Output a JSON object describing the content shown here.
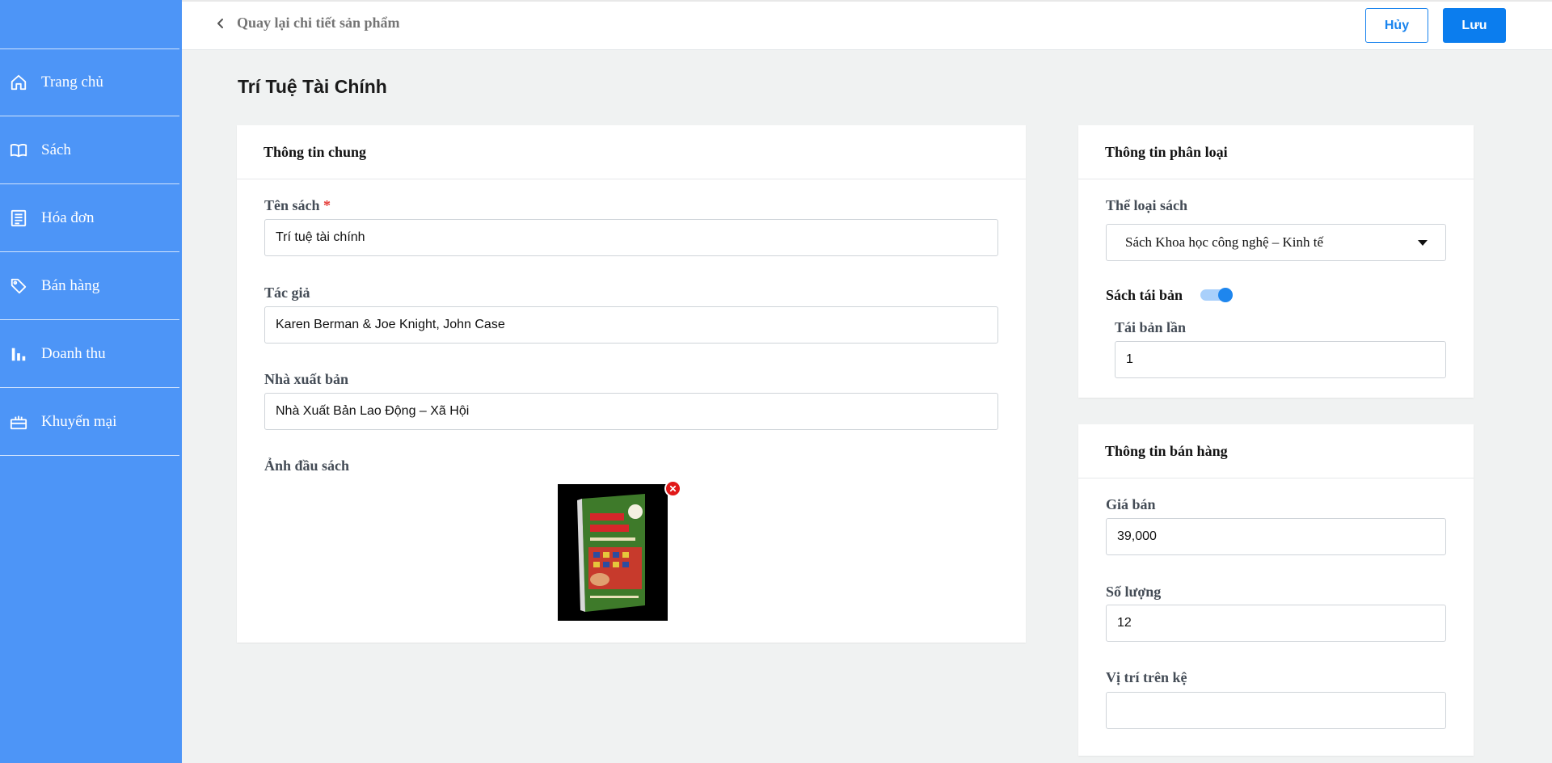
{
  "sidebar": {
    "items": [
      {
        "label": "Trang chủ",
        "icon": "home-icon"
      },
      {
        "label": "Sách",
        "icon": "book-icon"
      },
      {
        "label": "Hóa đơn",
        "icon": "receipt-icon"
      },
      {
        "label": "Bán hàng",
        "icon": "tag-icon"
      },
      {
        "label": "Doanh thu",
        "icon": "bar-chart-icon"
      },
      {
        "label": "Khuyến mại",
        "icon": "gift-icon"
      }
    ]
  },
  "header": {
    "back_label": "Quay lại chi tiết sản phẩm",
    "cancel_label": "Hủy",
    "save_label": "Lưu"
  },
  "page": {
    "title": "Trí Tuệ Tài Chính"
  },
  "general": {
    "heading": "Thông tin chung",
    "name_label": "Tên sách",
    "name_required": "*",
    "name_value": "Trí tuệ tài chính",
    "author_label": "Tác giả",
    "author_value": "Karen Berman & Joe Knight, John Case",
    "publisher_label": "Nhà xuất bản",
    "publisher_value": "Nhà Xuất Bản Lao Động – Xã Hội",
    "cover_label": "Ảnh đầu sách"
  },
  "classification": {
    "heading": "Thông tin phân loại",
    "category_label": "Thể loại sách",
    "category_value": "Sách Khoa học công nghệ – Kinh tế",
    "reprint_label": "Sách tái bản",
    "reprint_on": true,
    "reprint_count_label": "Tái bản lần",
    "reprint_count_value": "1"
  },
  "sales": {
    "heading": "Thông tin bán hàng",
    "price_label": "Giá bán",
    "price_value": "39,000",
    "quantity_label": "Số lượng",
    "quantity_value": "12",
    "shelf_label": "Vị trí trên kệ",
    "shelf_value": ""
  },
  "colors": {
    "sidebar": "#4d95f7",
    "primary": "#0b7dee",
    "danger": "#e11919"
  }
}
